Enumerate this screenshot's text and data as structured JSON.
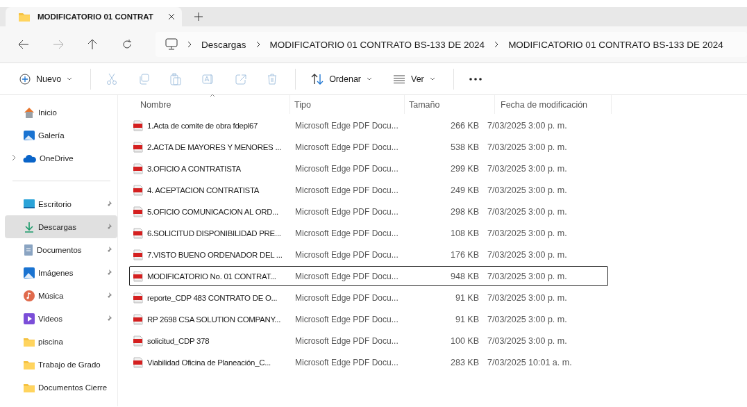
{
  "tab": {
    "title": "MODIFICATORIO 01 CONTRAT"
  },
  "breadcrumbs": [
    "Descargas",
    "MODIFICATORIO 01 CONTRATO BS-133 DE 2024",
    "MODIFICATORIO 01 CONTRATO BS-133 DE 2024"
  ],
  "toolbar": [
    {
      "kind": "new",
      "label": "Nuevo",
      "disabled": false
    },
    {
      "kind": "cut",
      "disabled": true
    },
    {
      "kind": "copy",
      "disabled": true
    },
    {
      "kind": "paste",
      "disabled": true
    },
    {
      "kind": "rename",
      "disabled": true
    },
    {
      "kind": "share",
      "disabled": true
    },
    {
      "kind": "delete",
      "disabled": true
    },
    {
      "kind": "sort",
      "label": "Ordenar",
      "disabled": false
    },
    {
      "kind": "view",
      "label": "Ver",
      "disabled": false
    },
    {
      "kind": "more",
      "disabled": false
    }
  ],
  "sidebar": {
    "top": [
      {
        "kind": "home",
        "label": "Inicio",
        "selected": false
      },
      {
        "kind": "gallery",
        "label": "Galería",
        "selected": false
      },
      {
        "kind": "cloud",
        "label": "OneDrive",
        "selected": false,
        "expanded": false
      }
    ],
    "items": [
      {
        "kind": "desktop",
        "label": "Escritorio",
        "pinned": true,
        "selected": false
      },
      {
        "kind": "download",
        "label": "Descargas",
        "pinned": true,
        "selected": true
      },
      {
        "kind": "document",
        "label": "Documentos",
        "pinned": true,
        "selected": false
      },
      {
        "kind": "images",
        "label": "Imágenes",
        "pinned": true,
        "selected": false
      },
      {
        "kind": "music",
        "label": "Música",
        "pinned": true,
        "selected": false
      },
      {
        "kind": "videos",
        "label": "Videos",
        "pinned": true,
        "selected": false
      },
      {
        "kind": "folder",
        "label": "piscina",
        "pinned": false,
        "selected": false
      },
      {
        "kind": "folder",
        "label": "Trabajo de Grado",
        "pinned": false,
        "selected": false
      },
      {
        "kind": "folder",
        "label": "Documentos Cierre",
        "pinned": false,
        "selected": false
      }
    ]
  },
  "table": {
    "columns": [
      "Nombre",
      "Tipo",
      "Tamaño",
      "Fecha de modificación"
    ],
    "rows": [
      {
        "name": "1.Acta de comite de obra fdepl67",
        "type": "Microsoft Edge PDF Docu...",
        "size": "266 KB",
        "date": "7/03/2025 3:00 p. m.",
        "focused": false
      },
      {
        "name": "2.ACTA DE MAYORES Y MENORES ...",
        "type": "Microsoft Edge PDF Docu...",
        "size": "538 KB",
        "date": "7/03/2025 3:00 p. m.",
        "focused": false
      },
      {
        "name": "3.OFICIO A CONTRATISTA",
        "type": "Microsoft Edge PDF Docu...",
        "size": "299 KB",
        "date": "7/03/2025 3:00 p. m.",
        "focused": false
      },
      {
        "name": "4. ACEPTACION CONTRATISTA",
        "type": "Microsoft Edge PDF Docu...",
        "size": "249 KB",
        "date": "7/03/2025 3:00 p. m.",
        "focused": false
      },
      {
        "name": "5.OFICIO COMUNICACION AL ORD...",
        "type": "Microsoft Edge PDF Docu...",
        "size": "298 KB",
        "date": "7/03/2025 3:00 p. m.",
        "focused": false
      },
      {
        "name": "6.SOLICITUD DISPONIBILIDAD PRE...",
        "type": "Microsoft Edge PDF Docu...",
        "size": "108 KB",
        "date": "7/03/2025 3:00 p. m.",
        "focused": false
      },
      {
        "name": "7.VISTO BUENO ORDENADOR DEL ...",
        "type": "Microsoft Edge PDF Docu...",
        "size": "176 KB",
        "date": "7/03/2025 3:00 p. m.",
        "focused": false
      },
      {
        "name": "MODIFICATORIO No. 01 CONTRAT...",
        "type": "Microsoft Edge PDF Docu...",
        "size": "948 KB",
        "date": "7/03/2025 3:00 p. m.",
        "focused": true
      },
      {
        "name": "reporte_CDP 483 CONTRATO DE O...",
        "type": "Microsoft Edge PDF Docu...",
        "size": "91 KB",
        "date": "7/03/2025 3:00 p. m.",
        "focused": false
      },
      {
        "name": "RP 2698 CSA SOLUTION COMPANY...",
        "type": "Microsoft Edge PDF Docu...",
        "size": "91 KB",
        "date": "7/03/2025 3:00 p. m.",
        "focused": false
      },
      {
        "name": "solicitud_CDP 378",
        "type": "Microsoft Edge PDF Docu...",
        "size": "100 KB",
        "date": "7/03/2025 3:00 p. m.",
        "focused": false
      },
      {
        "name": "Viabilidad Oficina de Planeación_C...",
        "type": "Microsoft Edge PDF Docu...",
        "size": "283 KB",
        "date": "7/03/2025 10:01 a. m.",
        "focused": false
      }
    ]
  }
}
